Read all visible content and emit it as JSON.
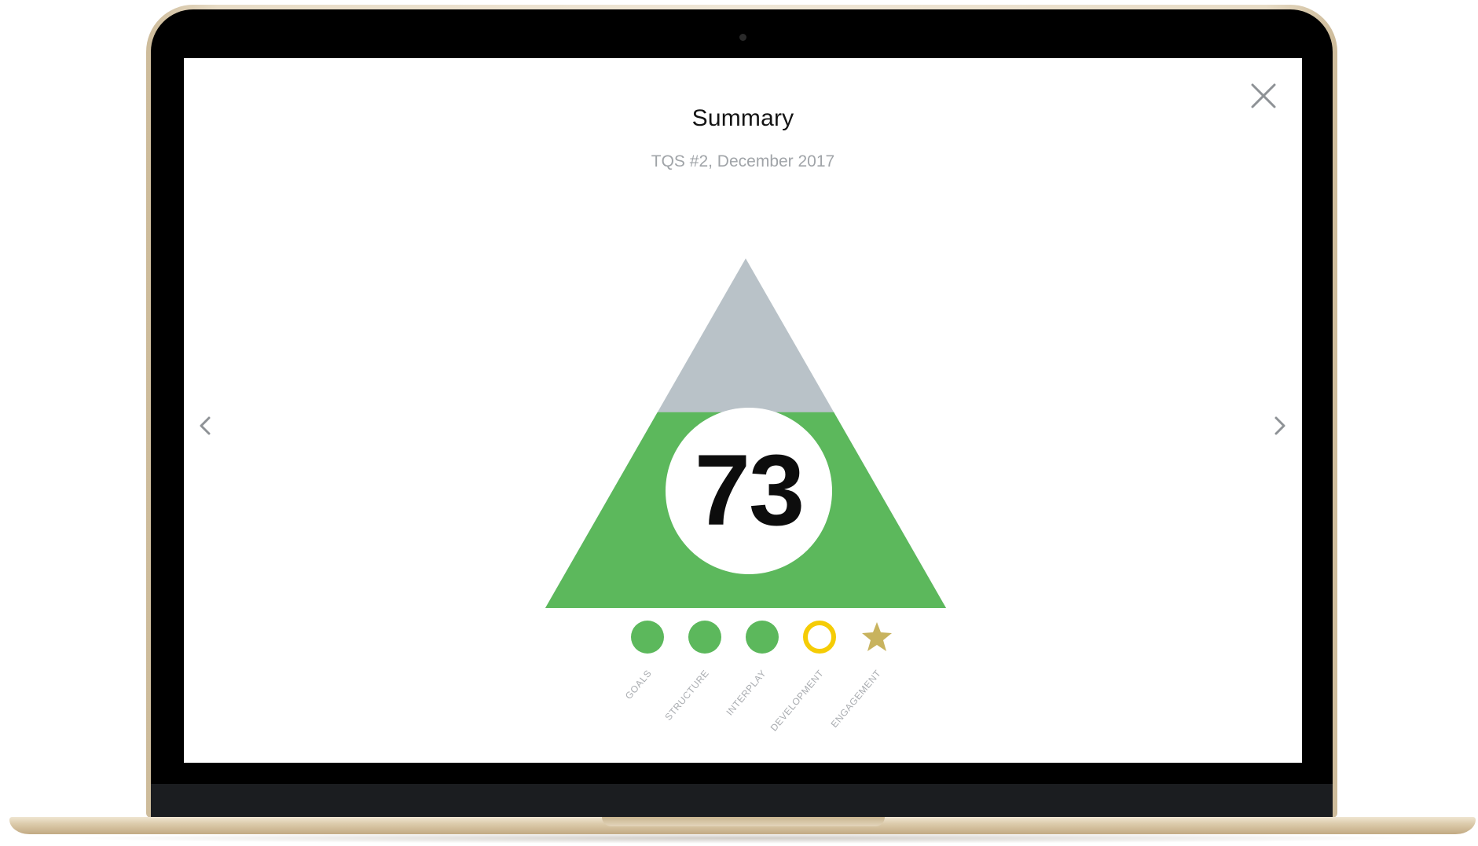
{
  "screen": {
    "title": "Summary",
    "subtitle": "TQS #2, December 2017",
    "score": "73"
  },
  "pyramid": {
    "fill_fraction": 0.56,
    "colors": {
      "filled": "#5cb85c",
      "remaining": "#b9c2c8"
    }
  },
  "indicators": [
    {
      "label": "GOALS",
      "status": "filled",
      "color": "#5cb85c",
      "icon": "filled-circle-icon"
    },
    {
      "label": "STRUCTURE",
      "status": "filled",
      "color": "#5cb85c",
      "icon": "filled-circle-icon"
    },
    {
      "label": "INTERPLAY",
      "status": "filled",
      "color": "#5cb85c",
      "icon": "filled-circle-icon"
    },
    {
      "label": "DEVELOPMENT",
      "status": "ring",
      "color": "#f5cc05",
      "icon": "ring-icon"
    },
    {
      "label": "ENGAGEMENT",
      "status": "star",
      "color": "#c8b35e",
      "icon": "star-icon"
    }
  ],
  "icons": {
    "close": "close-icon",
    "prev": "chevron-left-icon",
    "next": "chevron-right-icon"
  }
}
